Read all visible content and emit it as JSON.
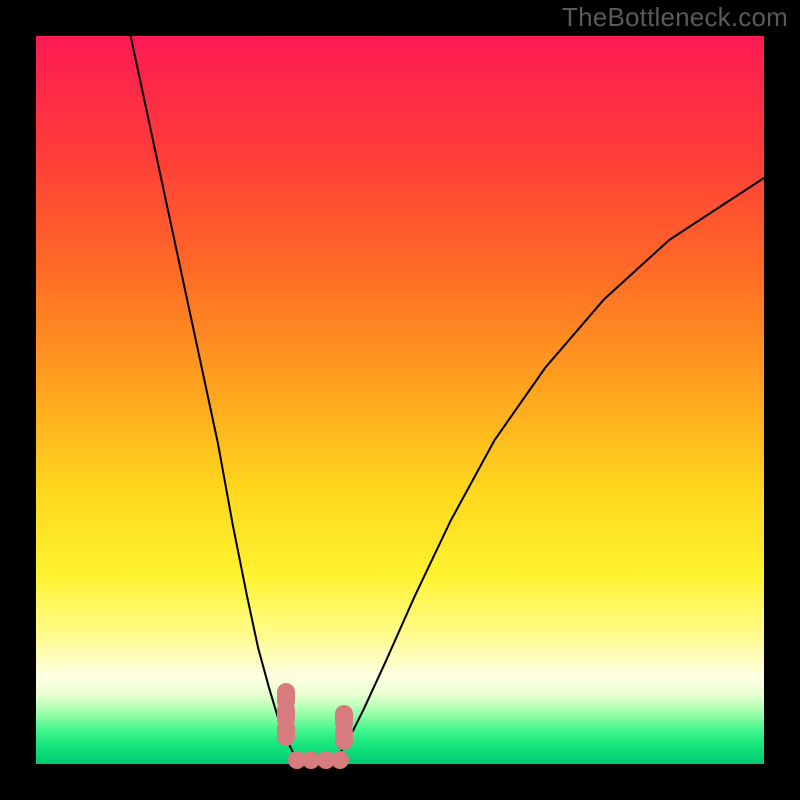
{
  "watermark": {
    "text": "TheBottleneck.com"
  },
  "chart_data": {
    "type": "line",
    "title": "",
    "xlabel": "",
    "ylabel": "",
    "xlim": [
      0,
      100
    ],
    "ylim": [
      0,
      100
    ],
    "series": [
      {
        "name": "bottleneck-curve-left",
        "x": [
          13,
          16,
          19,
          22,
          25,
          27,
          29,
          30.5,
          32,
          33.2,
          34.3,
          35.3,
          36.2,
          37
        ],
        "y": [
          100,
          86,
          72,
          58,
          44,
          33,
          23,
          16,
          10.5,
          6.5,
          3.6,
          1.6,
          0.5,
          0
        ]
      },
      {
        "name": "bottleneck-curve-right",
        "x": [
          40,
          41.5,
          43,
          45,
          48,
          52,
          57,
          63,
          70,
          78,
          87,
          100
        ],
        "y": [
          0,
          1.1,
          3.5,
          7.5,
          14,
          23,
          33.5,
          44.5,
          54.5,
          63.8,
          72,
          80.5
        ]
      }
    ],
    "markers": {
      "left_vertical": {
        "x_pct": 34.3,
        "ys_pct": [
          4,
          6.5,
          9
        ]
      },
      "center_baseline": {
        "xs_pct": [
          35.8,
          37.8,
          39.8,
          41.8
        ],
        "y_pct": 0.6
      },
      "right_vertical": {
        "x_pct": 42.3,
        "ys_pct": [
          3.5,
          6
        ]
      }
    },
    "gradient_stops": [
      {
        "offset": 0.0,
        "color": "#ff1a53"
      },
      {
        "offset": 0.16,
        "color": "#ff3c3a"
      },
      {
        "offset": 0.32,
        "color": "#ff6a26"
      },
      {
        "offset": 0.48,
        "color": "#ffa11e"
      },
      {
        "offset": 0.62,
        "color": "#ffd61e"
      },
      {
        "offset": 0.74,
        "color": "#fff22e"
      },
      {
        "offset": 0.82,
        "color": "#fffc8a"
      },
      {
        "offset": 0.88,
        "color": "#feffe3"
      },
      {
        "offset": 0.905,
        "color": "#e8ffcf"
      },
      {
        "offset": 0.93,
        "color": "#9cffab"
      },
      {
        "offset": 0.955,
        "color": "#3ef58a"
      },
      {
        "offset": 0.975,
        "color": "#14e47c"
      },
      {
        "offset": 1.0,
        "color": "#00c96f"
      }
    ],
    "marker_color": "#d77b7e"
  }
}
